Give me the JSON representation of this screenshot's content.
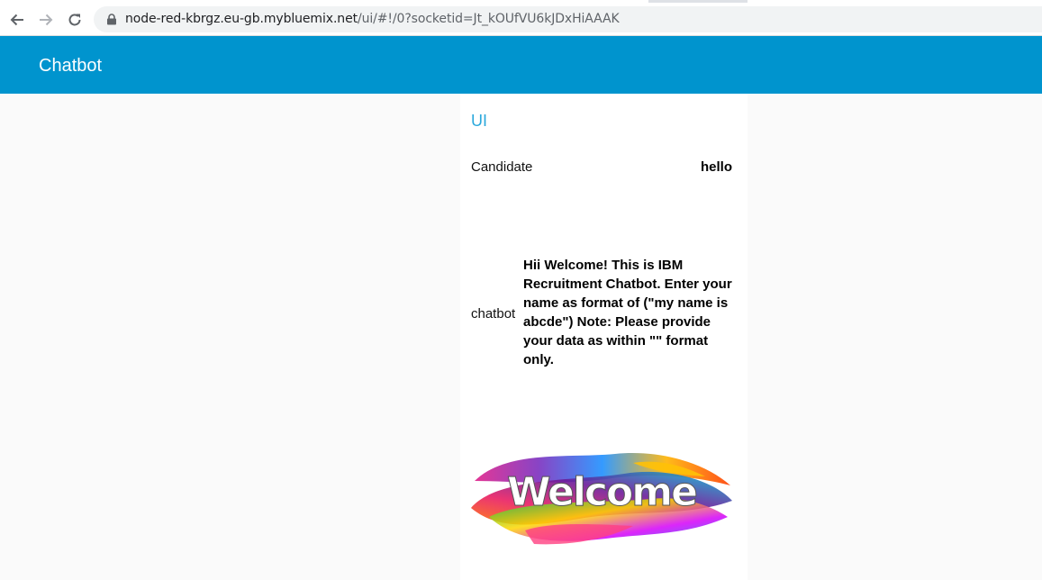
{
  "browser": {
    "url_host": "node-red-kbrgz.eu-gb.mybluemix.net",
    "url_path": "/ui/#!/0?socketid=Jt_kOUfVU6kJDxHiAAAK"
  },
  "app": {
    "title": "Chatbot",
    "header_color": "#0094ce"
  },
  "group": {
    "title": "UI",
    "title_color": "#2aa8dc"
  },
  "candidate": {
    "label": "Candidate",
    "value": "hello"
  },
  "chatbot": {
    "label": "chatbot",
    "message": "Hii Welcome! This is IBM Recruitment Chatbot. Enter your name as format of (\"my name is abcde\") Note: Please provide your data as within \"\" format only."
  },
  "welcome_image": {
    "text": "Welcome"
  }
}
